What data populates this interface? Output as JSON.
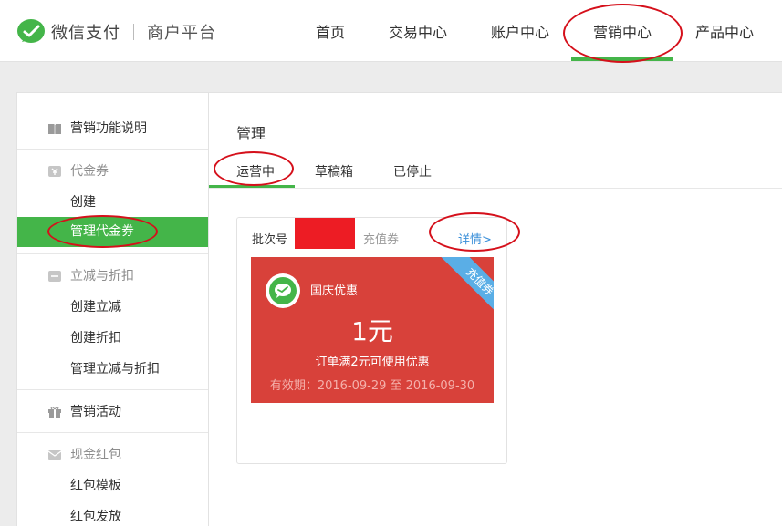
{
  "header": {
    "brand": "微信支付",
    "platform": "商户平台",
    "nav": [
      {
        "label": "首页"
      },
      {
        "label": "交易中心"
      },
      {
        "label": "账户中心"
      },
      {
        "label": "营销中心",
        "active": true
      },
      {
        "label": "产品中心"
      }
    ]
  },
  "sidebar": {
    "intro": {
      "label": "营销功能说明",
      "icon": "book-icon"
    },
    "voucher": {
      "label": "代金券",
      "icon": "yen-icon",
      "items": [
        {
          "label": "创建"
        },
        {
          "label": "管理代金券",
          "active": true
        }
      ]
    },
    "discount": {
      "label": "立减与折扣",
      "icon": "minus-badge-icon",
      "items": [
        {
          "label": "创建立减"
        },
        {
          "label": "创建折扣"
        },
        {
          "label": "管理立减与折扣"
        }
      ]
    },
    "activity": {
      "label": "营销活动",
      "icon": "gift-icon"
    },
    "redpacket": {
      "label": "现金红包",
      "icon": "envelope-icon",
      "items": [
        {
          "label": "红包模板"
        },
        {
          "label": "红包发放"
        }
      ]
    }
  },
  "main": {
    "title": "管理",
    "tabs": [
      {
        "label": "运营中",
        "active": true
      },
      {
        "label": "草稿箱"
      },
      {
        "label": "已停止"
      }
    ],
    "card": {
      "batch_label": "批次号",
      "type_label": "充值券",
      "detail_link": "详情>",
      "coupon": {
        "name": "国庆优惠",
        "value": "1元",
        "condition": "订单满2元可使用优惠",
        "validity": "有效期：2016-09-29 至 2016-09-30",
        "ribbon": "充值券"
      }
    }
  },
  "colors": {
    "accent_green": "#44b549",
    "coupon_red": "#d8413a",
    "link_blue": "#3a8fd9",
    "annotation_red": "#d5101b",
    "redaction_red": "#ed1c24"
  }
}
